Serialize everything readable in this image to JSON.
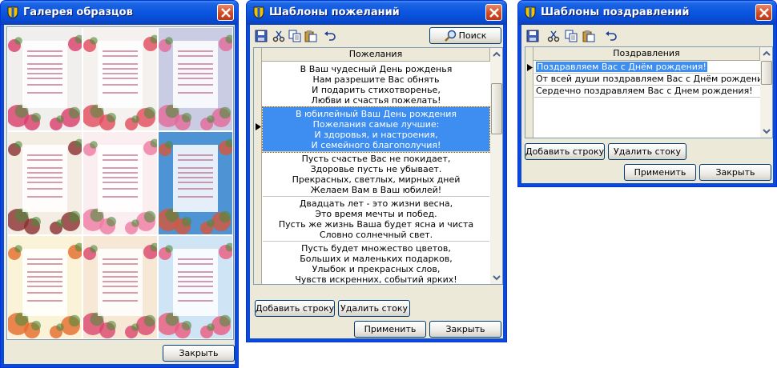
{
  "gallery_window": {
    "title": "Галерея образцов",
    "close_label": "Закрыть",
    "thumbnails": [
      {
        "name": "sample-1",
        "bg": "#f1efee",
        "flower": "#d93d6a"
      },
      {
        "name": "sample-2",
        "bg": "#f4f1ee",
        "flower": "#e44b5b"
      },
      {
        "name": "sample-3",
        "bg": "#c9cce2",
        "flower": "#e46a9a"
      },
      {
        "name": "sample-4",
        "bg": "#f4ede4",
        "flower": "#8a3030"
      },
      {
        "name": "sample-5",
        "bg": "#fbeef0",
        "flower": "#f07aa2"
      },
      {
        "name": "sample-6",
        "bg": "#4e93d3",
        "flower": "#d8563a"
      },
      {
        "name": "sample-7",
        "bg": "#fbf3d8",
        "flower": "#e56a2a"
      },
      {
        "name": "sample-8",
        "bg": "#f7e8d6",
        "flower": "#d9456d"
      },
      {
        "name": "sample-9",
        "bg": "#cfe4f4",
        "flower": "#ea5a7e"
      }
    ]
  },
  "wishes_window": {
    "title": "Шаблоны пожеланий",
    "search_label": "Поиск",
    "column_header": "Пожелания",
    "rows": [
      {
        "lines": [
          "В Ваш чудесный День рожденья",
          "Нам разрешите Вас обнять",
          "И подарить стихотворенье,",
          "Любви и счастья пожелать!"
        ],
        "selected": false
      },
      {
        "lines": [
          "В юбилейный Ваш День рождения",
          "Пожелания самые лучшие:",
          "И здоровья, и настроения,",
          "И семейного благополучия!"
        ],
        "selected": true
      },
      {
        "lines": [
          "Пусть счастье Вас не покидает,",
          "Здоровье пусть не убывает.",
          "Прекрасных, светлых, мирных дней",
          "Желаем Вам в Ваш юбилей!"
        ],
        "selected": false
      },
      {
        "lines": [
          "Двадцать лет - это жизни весна,",
          "Это время мечты и побед.",
          "Пусть же жизнь Ваша будет ясна и чиста",
          "Словно солнечный свет."
        ],
        "selected": false
      },
      {
        "lines": [
          "Пусть будет множество цветов,",
          "Больших и маленьких подарков,",
          "Улыбок и прекрасных слов,",
          "Чувств искренних, событий ярких!"
        ],
        "selected": false
      }
    ],
    "add_row_label": "Добавить строку",
    "delete_row_label": "Удалить стоку",
    "apply_label": "Применить",
    "close_label": "Закрыть"
  },
  "greetings_window": {
    "title": "Шаблоны поздравлений",
    "column_header": "Поздравления",
    "rows": [
      {
        "text": "Поздравляем Вас с Днём рождения!",
        "selected": true
      },
      {
        "text": "От всей души поздравляем Вас с Днём рождения!",
        "selected": false
      },
      {
        "text": "Сердечно поздравляем Вас с Днем рождения!",
        "selected": false
      }
    ],
    "add_row_label": "Добавить строку",
    "delete_row_label": "Удалить стоку",
    "apply_label": "Применить",
    "close_label": "Закрыть"
  },
  "colors": {
    "titlebar": "#0a55e0",
    "selection": "#3d8ef0",
    "face": "#ece9d8"
  }
}
